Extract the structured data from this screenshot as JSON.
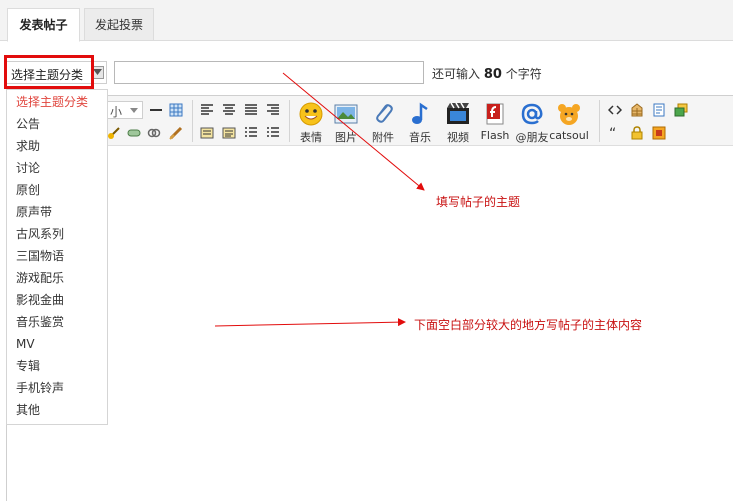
{
  "tabs": [
    {
      "label": "发表帖子",
      "active": true
    },
    {
      "label": "发起投票",
      "active": false
    }
  ],
  "subject": {
    "category_label": "选择主题分类",
    "title_value": "",
    "remaining_prefix": "还可输入",
    "remaining_count": "80",
    "remaining_suffix": "个字符"
  },
  "toolbar": {
    "font_size_value": "小",
    "buttons": [
      {
        "label": "表情",
        "icon": "smiley-icon"
      },
      {
        "label": "图片",
        "icon": "image-icon"
      },
      {
        "label": "附件",
        "icon": "paperclip-icon"
      },
      {
        "label": "音乐",
        "icon": "music-note-icon"
      },
      {
        "label": "视频",
        "icon": "film-icon"
      },
      {
        "label": "Flash",
        "icon": "flash-icon"
      },
      {
        "label": "@朋友",
        "icon": "at-icon"
      },
      {
        "label": "catsoul",
        "icon": "bear-icon"
      }
    ]
  },
  "category_dropdown": {
    "items": [
      "选择主题分类",
      "公告",
      "求助",
      "讨论",
      "原创",
      "原声带",
      "古风系列",
      "三国物语",
      "游戏配乐",
      "影视金曲",
      "音乐鉴赏",
      "MV",
      "专辑",
      "手机铃声",
      "其他"
    ],
    "selected_index": 0
  },
  "annotations": {
    "subject_hint": "填写帖子的主题",
    "body_hint": "下面空白部分较大的地方写帖子的主体内容"
  },
  "colors": {
    "annotation_red": "#c81010",
    "highlight_red": "#e20c0c",
    "selected_item": "#e0463e"
  }
}
